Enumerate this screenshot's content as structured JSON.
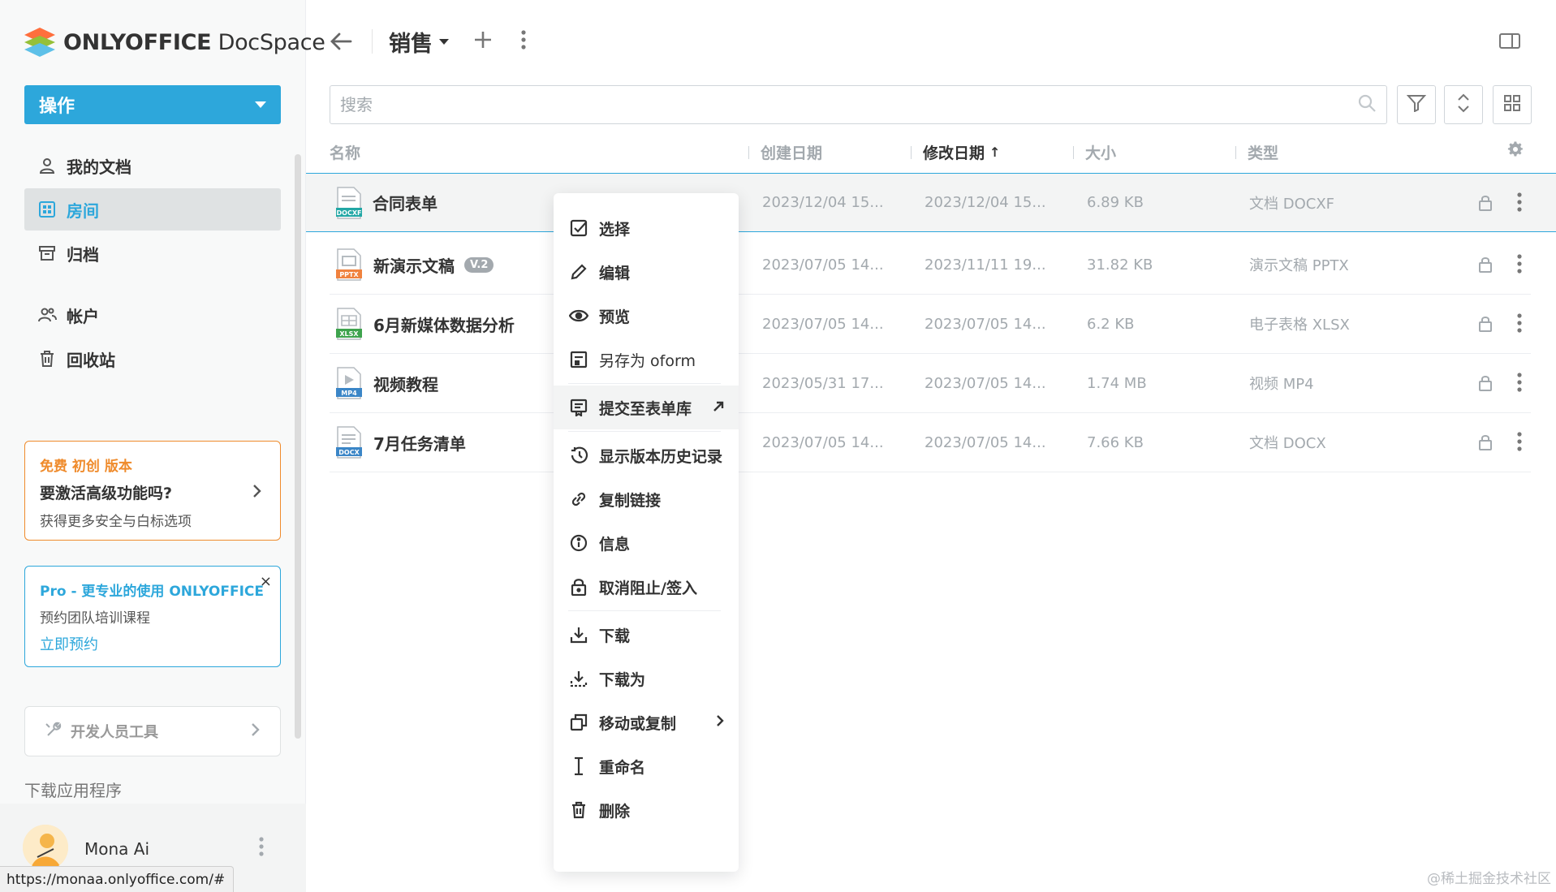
{
  "brand": {
    "name_bold": "ONLYOFFICE",
    "name_light": " DocSpace"
  },
  "sidebar": {
    "action_button": "操作",
    "items": [
      {
        "label": "我的文档",
        "icon": "person-icon",
        "active": false
      },
      {
        "label": "房间",
        "icon": "rooms-icon",
        "active": true
      },
      {
        "label": "归档",
        "icon": "archive-icon",
        "active": false
      },
      {
        "label": "帐户",
        "icon": "accounts-icon",
        "active": false
      },
      {
        "label": "回收站",
        "icon": "trash-icon",
        "active": false
      }
    ],
    "promo_free": {
      "title": "免费 初创 版本",
      "heading": "要激活高级功能吗?",
      "desc": "获得更多安全与白标选项"
    },
    "promo_pro": {
      "title": "Pro - 更专业的使用 ONLYOFFICE",
      "desc": "预约团队培训课程",
      "link": "立即预约",
      "close": "×"
    },
    "dev_tools": "开发人员工具",
    "download_app": "下载应用程序",
    "profile": {
      "name": "Mona Ai"
    }
  },
  "status_url": "https://monaa.onlyoffice.com/#",
  "header": {
    "title": "销售"
  },
  "search": {
    "placeholder": "搜索"
  },
  "table": {
    "columns": {
      "name": "名称",
      "created": "创建日期",
      "modified": "修改日期",
      "size": "大小",
      "type": "类型"
    },
    "sort_arrow": "↑",
    "rows": [
      {
        "name": "合同表单",
        "ext": "DOCXF",
        "ext_color": "#22a7a5",
        "version": "",
        "created": "2023/12/04 15...",
        "modified": "2023/12/04 15...",
        "size": "6.89 KB",
        "type": "文档 DOCXF"
      },
      {
        "name": "新演示文稿",
        "ext": "PPTX",
        "ext_color": "#f0823e",
        "version": "V.2",
        "created": "2023/07/05 14...",
        "modified": "2023/11/11 19...",
        "size": "31.82 KB",
        "type": "演示文稿 PPTX"
      },
      {
        "name": "6月新媒体数据分析",
        "ext": "XLSX",
        "ext_color": "#3ea34d",
        "version": "",
        "created": "2023/07/05 14...",
        "modified": "2023/07/05 14...",
        "size": "6.2 KB",
        "type": "电子表格 XLSX"
      },
      {
        "name": "视频教程",
        "ext": "MP4",
        "ext_color": "#3b86c7",
        "version": "",
        "created": "2023/05/31 17...",
        "modified": "2023/07/05 14...",
        "size": "1.74 MB",
        "type": "视频 MP4"
      },
      {
        "name": "7月任务清单",
        "ext": "DOCX",
        "ext_color": "#3b86c7",
        "version": "",
        "created": "2023/07/05 14...",
        "modified": "2023/07/05 14...",
        "size": "7.66 KB",
        "type": "文档 DOCX"
      }
    ]
  },
  "context_menu": {
    "select": "选择",
    "edit": "编辑",
    "preview": "预览",
    "save_oform": "另存为 oform",
    "submit_gallery": "提交至表单库",
    "version_history": "显示版本历史记录",
    "copy_link": "复制链接",
    "info": "信息",
    "unblock": "取消阻止/签入",
    "download": "下载",
    "download_as": "下载为",
    "move_copy": "移动或复制",
    "rename": "重命名",
    "delete": "删除"
  },
  "watermark": "@稀土掘金技术社区",
  "colors": {
    "accent": "#2da7db",
    "promo_orange": "#ef8b2c"
  }
}
